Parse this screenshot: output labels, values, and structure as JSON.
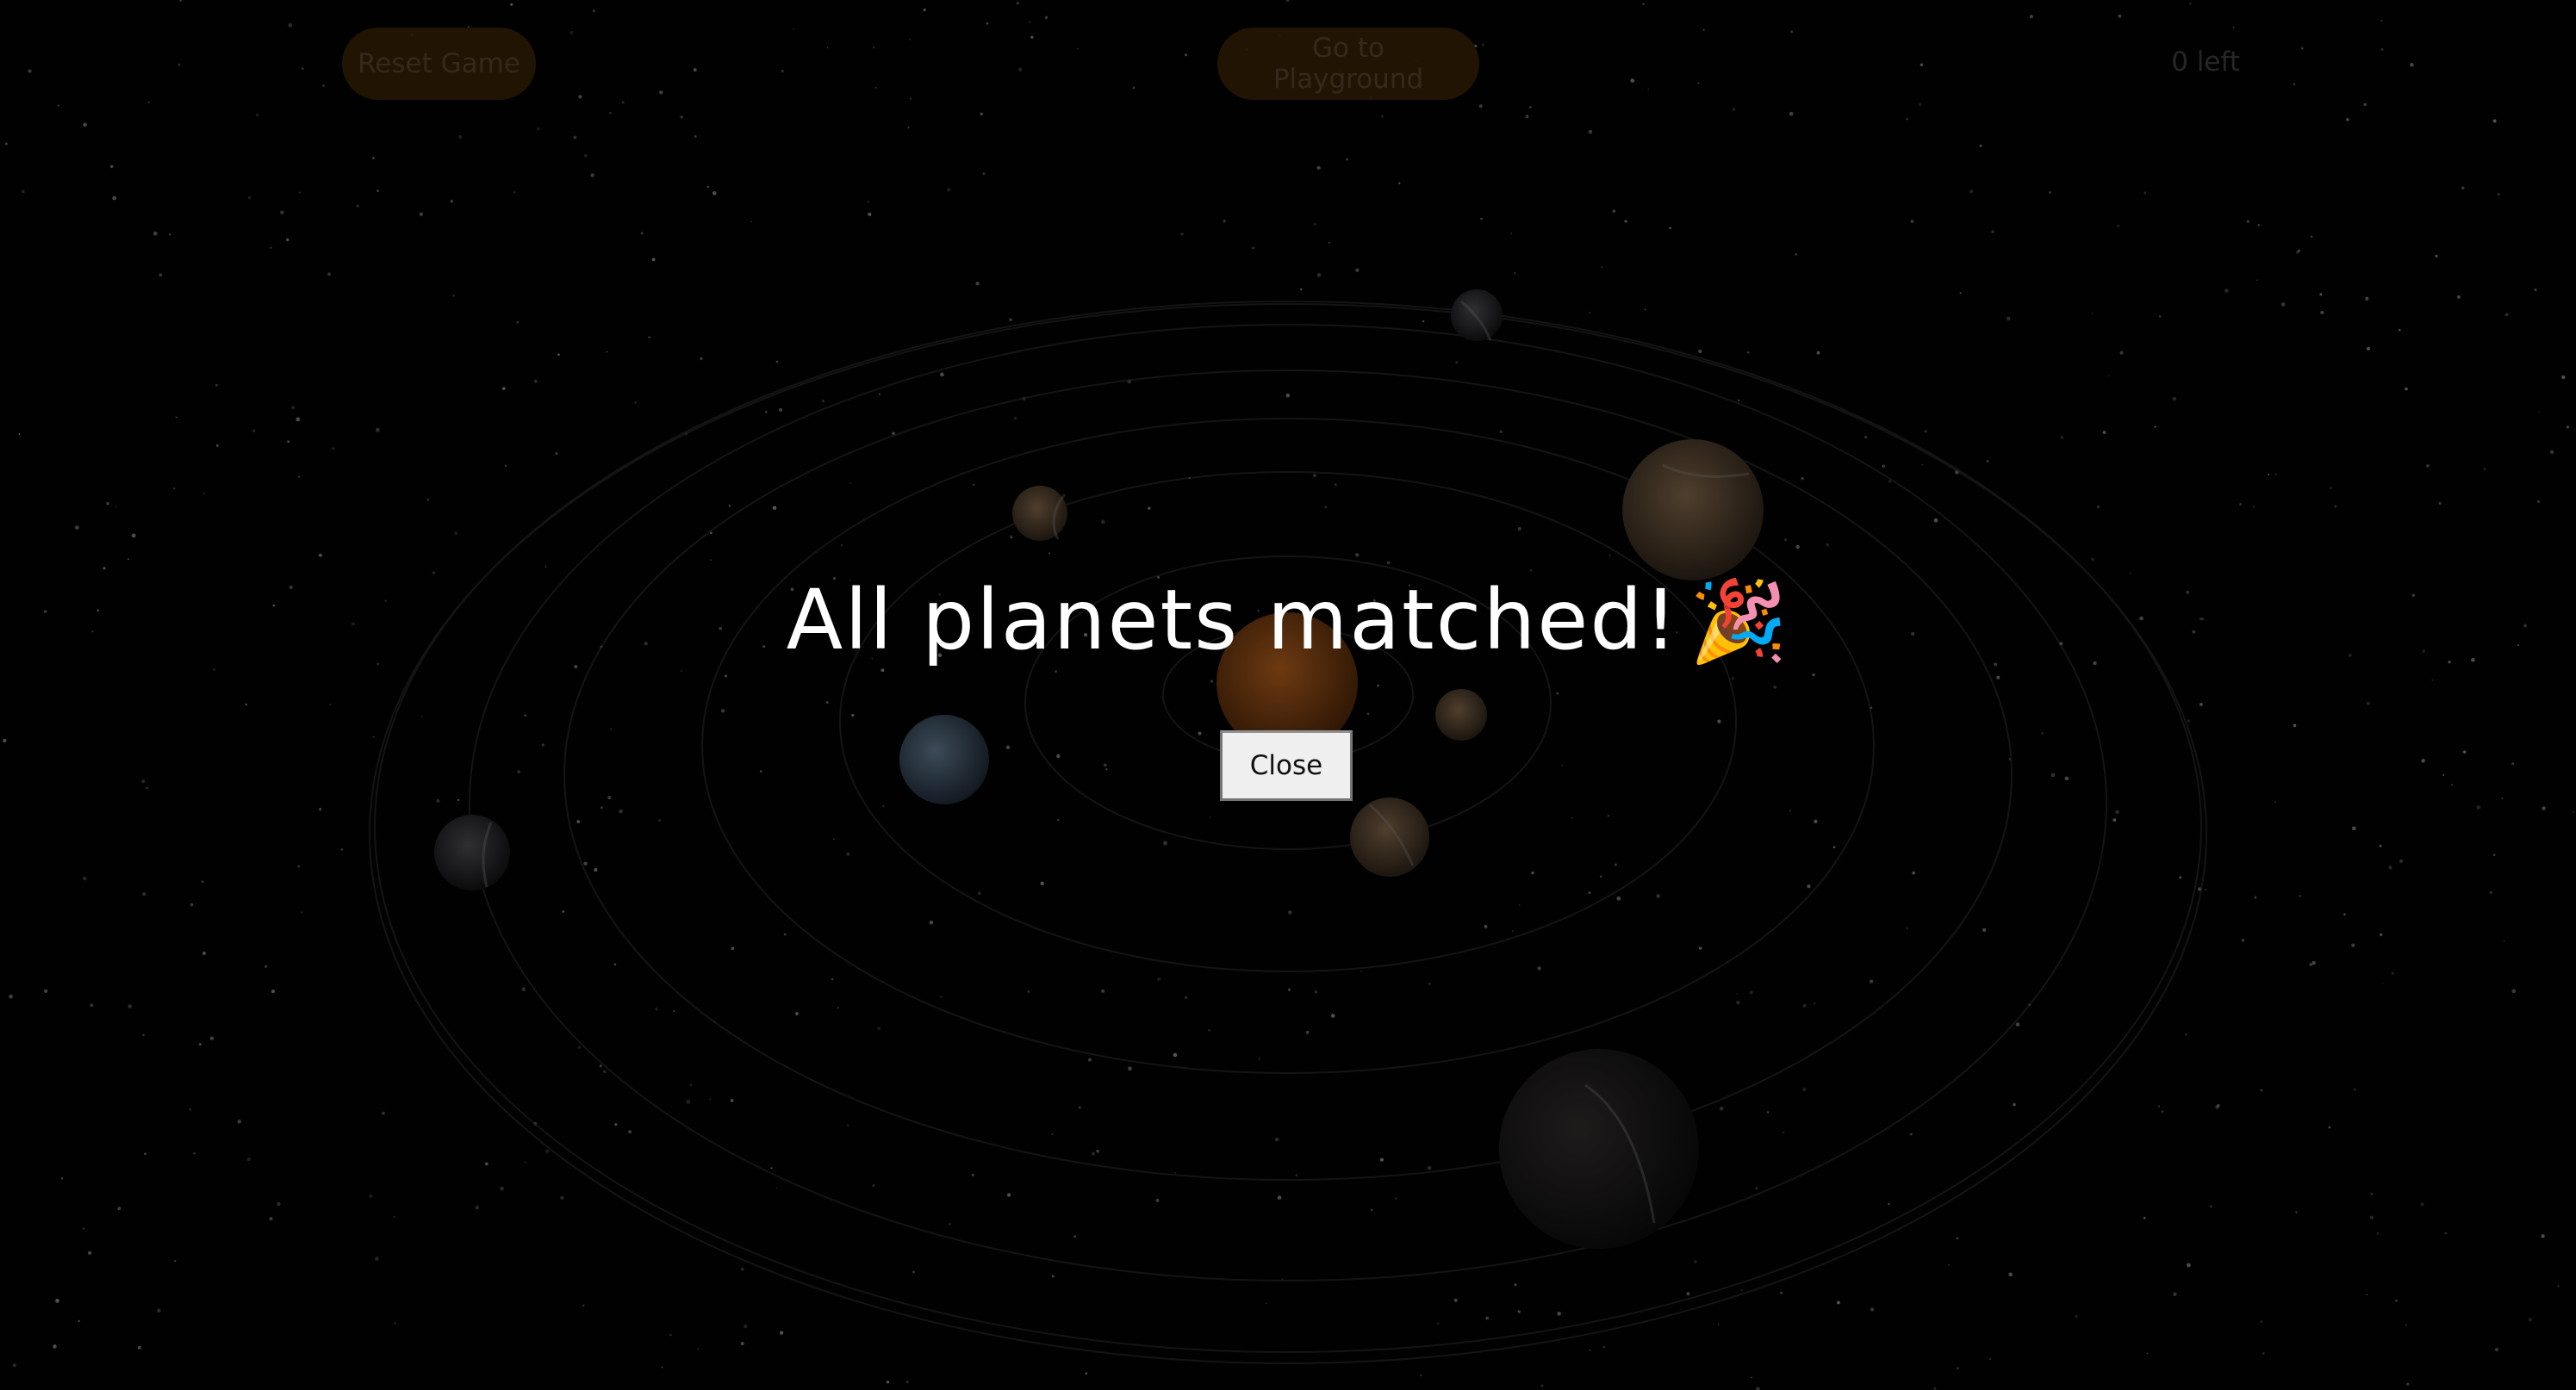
{
  "header": {
    "reset_label": "Reset Game",
    "playground_label": "Go to Playground",
    "remaining_text": "0 left"
  },
  "modal": {
    "message": "All planets matched!",
    "emoji": "🎉",
    "close_label": "Close"
  },
  "colors": {
    "background": "#020202",
    "button_bg": "#3a2306",
    "button_text": "#5a4630",
    "orbit_line": "#3a3a3a",
    "sun": "#7a3f10"
  },
  "icons": {
    "celebration": "party-popper-icon"
  }
}
